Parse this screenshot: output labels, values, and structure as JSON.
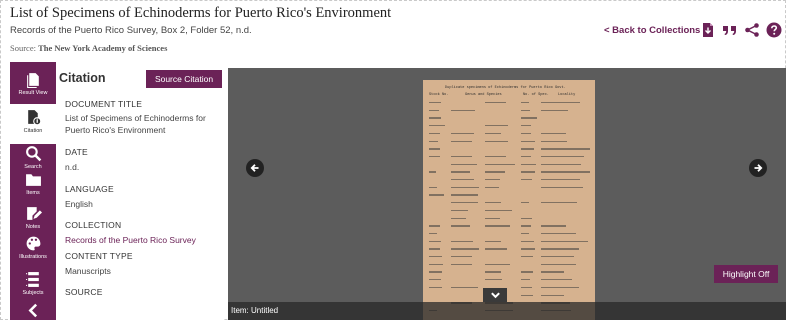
{
  "header": {
    "title": "List of Specimens of Echinoderms for Puerto Rico's Environment",
    "subtitle": "Records of the Puerto Rico Survey, Box 2, Folder 52, n.d.",
    "source_label": "Source:",
    "source_value": "The New York Academy of Sciences",
    "back_link": "< Back to Collections",
    "icons": [
      "pdf-icon",
      "quote-icon",
      "share-icon",
      "help-icon"
    ]
  },
  "sidebar": {
    "items": [
      {
        "label": "Result View",
        "icon": "result-view-icon"
      },
      {
        "label": "Citation",
        "icon": "citation-icon"
      },
      {
        "label": "Search",
        "icon": "search-icon"
      },
      {
        "label": "Items",
        "icon": "folder-icon"
      },
      {
        "label": "Notes",
        "icon": "notes-icon"
      },
      {
        "label": "Illustrations",
        "icon": "palette-icon"
      },
      {
        "label": "Subjects",
        "icon": "subjects-icon"
      }
    ]
  },
  "citation": {
    "title": "Citation",
    "source_button": "Source Citation",
    "fields": [
      {
        "label": "DOCUMENT TITLE",
        "value": "List of Specimens of Echinoderms for Puerto Rico's Environment"
      },
      {
        "label": "DATE",
        "value": "n.d."
      },
      {
        "label": "LANGUAGE",
        "value": "English"
      },
      {
        "label": "COLLECTION",
        "value": "Records of the Puerto Rico Survey"
      },
      {
        "label": "CONTENT TYPE",
        "value": "Manuscripts"
      },
      {
        "label": "SOURCE",
        "value": ""
      }
    ]
  },
  "viewer": {
    "highlight_button": "Highlight Off",
    "caption": "Item: Untitled",
    "doc_heading": "Duplicate specimens of Echinoderms for Puerto Rico Govt.",
    "doc_columns": [
      "Stock No.",
      "Genus and Species",
      "No. of Spec.",
      "Locality"
    ]
  },
  "colors": {
    "accent": "#6b2257",
    "viewer_bg": "#5c5c5c",
    "document": "#d6b28f"
  }
}
